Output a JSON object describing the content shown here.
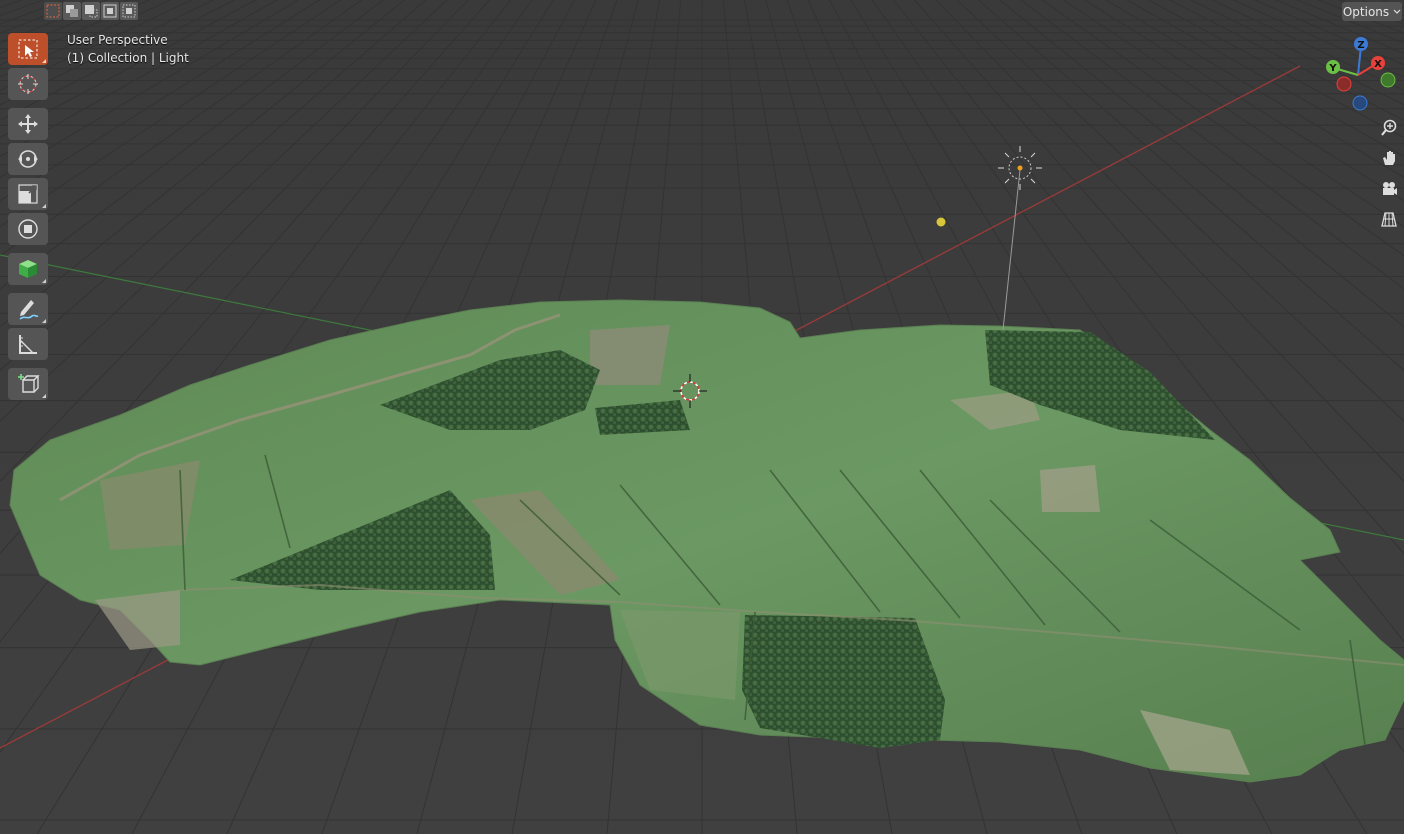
{
  "viewport": {
    "view_name": "User Perspective",
    "collection_info": "(1) Collection | Light"
  },
  "header": {
    "options_label": "Options",
    "selection_modes": [
      "select-new",
      "select-extend",
      "select-subtract",
      "select-invert",
      "select-intersect"
    ]
  },
  "toolbar": {
    "tools": [
      "select-box-icon",
      "cursor-icon",
      "move-icon",
      "rotate-icon",
      "scale-icon",
      "transform-icon",
      "add-cube-icon",
      "annotate-icon",
      "measure-icon",
      "add-object-icon"
    ],
    "active_tool": "select-box-icon"
  },
  "gizmo": {
    "x_label": "X",
    "y_label": "Y",
    "z_label": "Z",
    "x_color": "#e8413b",
    "y_color": "#6bbf45",
    "z_color": "#3b7bd6"
  },
  "nav_controls": [
    "zoom-icon",
    "pan-hand-icon",
    "camera-icon",
    "grid-view-icon"
  ],
  "colors": {
    "background": "#3d3d3d",
    "grid": "#353535",
    "x_axis": "#a33a3a",
    "y_axis": "#3f7a3f",
    "active_tool": "#bd4f2a",
    "terrain": "#4f7a45"
  }
}
